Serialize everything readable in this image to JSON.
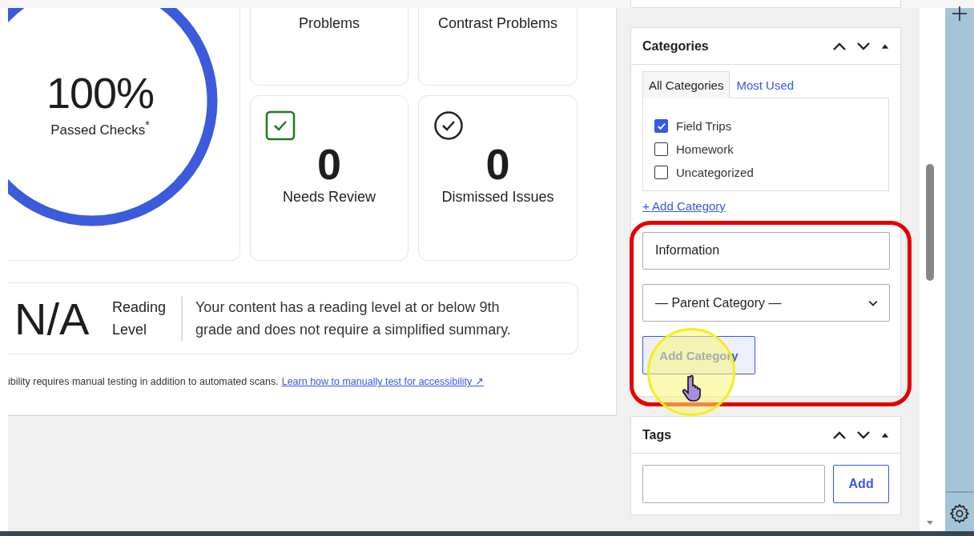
{
  "score": {
    "value": "100%",
    "label": "Passed Checks$^{*}$"
  },
  "stat_cards": [
    {
      "kind": "label",
      "label": "Problems"
    },
    {
      "kind": "label",
      "label": "Contrast Problems"
    },
    {
      "kind": "count",
      "value": "0",
      "label": "Needs Review"
    },
    {
      "kind": "count",
      "value": "0",
      "label": "Dismissed Issues"
    }
  ],
  "reading": {
    "value": "N/A",
    "label": "Reading Level",
    "text": "Your content has a reading level at or below 9th grade and does not require a simplified summary."
  },
  "footer": {
    "text": "ibility requires manual testing in addition to automated scans.",
    "link": "Learn how to manually test for accessibility ↗"
  },
  "categories": {
    "title": "Categories",
    "tabs": [
      {
        "label": "All Categories",
        "selected": true
      },
      {
        "label": "Most Used",
        "selected": false
      }
    ],
    "items": [
      {
        "label": "Field Trips",
        "checked": true
      },
      {
        "label": "Homework",
        "checked": false
      },
      {
        "label": "Uncategorized",
        "checked": false
      }
    ],
    "add_link": "+ Add Category",
    "new_category": {
      "value": "Information"
    },
    "parent_select": {
      "value": "— Parent Category —"
    },
    "submit": "Add Category"
  },
  "tags": {
    "title": "Tags",
    "button": "Add"
  }
}
